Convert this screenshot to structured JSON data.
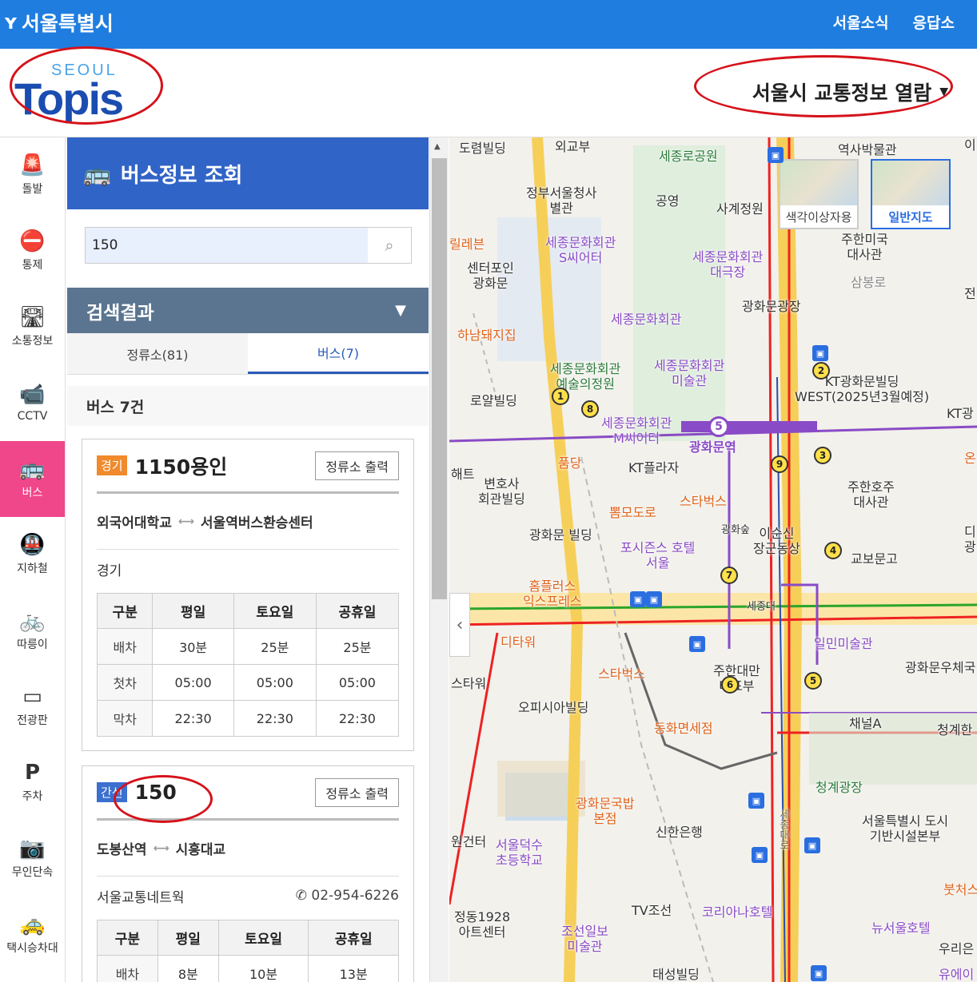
{
  "topbar": {
    "city": "서울특별시",
    "links": [
      "서울소식",
      "응답소"
    ]
  },
  "header": {
    "logo_top": "SEOUL",
    "logo_main": "Topis",
    "view_select": "서울시 교통정보 열람"
  },
  "nav": [
    {
      "label": "돌발",
      "icon": "siren-icon",
      "glyph": "🚨"
    },
    {
      "label": "통제",
      "icon": "no-entry-icon",
      "glyph": "⛔"
    },
    {
      "label": "소통정보",
      "icon": "road-icon",
      "glyph": "🛣"
    },
    {
      "label": "CCTV",
      "icon": "camera-icon",
      "glyph": "📹"
    },
    {
      "label": "버스",
      "icon": "bus-icon",
      "glyph": "🚌",
      "active": true
    },
    {
      "label": "지하철",
      "icon": "subway-icon",
      "glyph": "🚇"
    },
    {
      "label": "따릉이",
      "icon": "bicycle-icon",
      "glyph": "🚲"
    },
    {
      "label": "전광판",
      "icon": "sign-board-icon",
      "glyph": "▭"
    },
    {
      "label": "주차",
      "icon": "parking-icon",
      "glyph": "P"
    },
    {
      "label": "무인단속",
      "icon": "speed-camera-icon",
      "glyph": "📷"
    },
    {
      "label": "택시승차대",
      "icon": "taxi-icon",
      "glyph": "🚕"
    }
  ],
  "panel": {
    "title": "버스정보 조회",
    "search": {
      "value": "150"
    },
    "results_title": "검색결과",
    "tabs": [
      {
        "label": "정류소(81)"
      },
      {
        "label": "버스(7)"
      }
    ],
    "count": "버스 7건",
    "cards": [
      {
        "badge": "경기",
        "number": "1150용인",
        "print": "정류소 출력",
        "from": "외국어대학교",
        "to": "서울역버스환승센터",
        "company": "경기",
        "phone": "",
        "headers": [
          "구분",
          "평일",
          "토요일",
          "공휴일"
        ],
        "rows": [
          [
            "배차",
            "30분",
            "25분",
            "25분"
          ],
          [
            "첫차",
            "05:00",
            "05:00",
            "05:00"
          ],
          [
            "막차",
            "22:30",
            "22:30",
            "22:30"
          ]
        ]
      },
      {
        "badge": "간선",
        "number": "150",
        "print": "정류소 출력",
        "from": "도봉산역",
        "to": "시흥대교",
        "company": "서울교통네트웍",
        "phone": "02-954-6226",
        "headers": [
          "구분",
          "평일",
          "토요일",
          "공휴일"
        ],
        "rows": [
          [
            "배차",
            "8분",
            "10분",
            "13분"
          ]
        ]
      }
    ]
  },
  "map": {
    "thumbs": [
      {
        "label": "색각이상자용"
      },
      {
        "label": "일반지도",
        "selected": true
      }
    ],
    "labels": [
      {
        "text": "도렴빌딩"
      },
      {
        "text": "외교부"
      },
      {
        "text": "세종로공원"
      },
      {
        "text": "역사박물관"
      },
      {
        "text": "정부서울청사\n별관"
      },
      {
        "text": "공영"
      },
      {
        "text": "사계정원"
      },
      {
        "text": "주한미국\n대사관"
      },
      {
        "text": "삼봉로"
      },
      {
        "text": "세종문화회관\nS씨어터"
      },
      {
        "text": "세종문화회관\n대극장"
      },
      {
        "text": "센터포인\n광화문"
      },
      {
        "text": "광화문광장"
      },
      {
        "text": "세종문화회관"
      },
      {
        "text": "하남돼지집"
      },
      {
        "text": "세종문화회관\n예술의정원"
      },
      {
        "text": "세종문화회관\n미술관"
      },
      {
        "text": "KT광화문빌딩\nWEST(2025년3월예정)"
      },
      {
        "text": "로얄빌딩"
      },
      {
        "text": "세종문화회관\nM씨어터"
      },
      {
        "text": "광화문역"
      },
      {
        "text": "KT플라자"
      },
      {
        "text": "변호사\n회관빌딩"
      },
      {
        "text": "스타벅스"
      },
      {
        "text": "주한호주\n대사관"
      },
      {
        "text": "뽐모도로"
      },
      {
        "text": "광화숲"
      },
      {
        "text": "이순신\n장군동상"
      },
      {
        "text": "교보문고"
      },
      {
        "text": "광화문 빌딩"
      },
      {
        "text": "포시즌스 호텔\n서울"
      },
      {
        "text": "홈플러스\n익스프레스"
      },
      {
        "text": "디타워"
      },
      {
        "text": "일민미술관"
      },
      {
        "text": "광화문우체국"
      },
      {
        "text": "스타벅스"
      },
      {
        "text": "주한대만\n대표부"
      },
      {
        "text": "오피시아빌딩"
      },
      {
        "text": "동화면세점"
      },
      {
        "text": "채널A"
      },
      {
        "text": "청계한"
      },
      {
        "text": "청계광장"
      },
      {
        "text": "광화문국밥\n본점"
      },
      {
        "text": "서울특별시 도시\n기반시설본부"
      },
      {
        "text": "신한은행"
      },
      {
        "text": "서울덕수\n초등학교"
      },
      {
        "text": "세종대로"
      },
      {
        "text": "정동1928\n아트센터"
      },
      {
        "text": "TV조선"
      },
      {
        "text": "코리아나호텔"
      },
      {
        "text": "조선일보\n미술관"
      },
      {
        "text": "뉴서울호텔"
      },
      {
        "text": "우리은"
      },
      {
        "text": "태성빌딩"
      },
      {
        "text": "유에이"
      },
      {
        "text": "붓처스"
      },
      {
        "text": "원건터"
      },
      {
        "text": "해트"
      },
      {
        "text": "이"
      },
      {
        "text": "전"
      },
      {
        "text": "KT광"
      },
      {
        "text": "온"
      },
      {
        "text": "디\n광"
      },
      {
        "text": "세종대"
      },
      {
        "text": "스타워"
      },
      {
        "text": "품당"
      },
      {
        "text": "릴레븐"
      }
    ],
    "gate_pins": [
      "1",
      "2",
      "3",
      "4",
      "5",
      "6",
      "7",
      "8",
      "9"
    ],
    "station_no": "5"
  }
}
